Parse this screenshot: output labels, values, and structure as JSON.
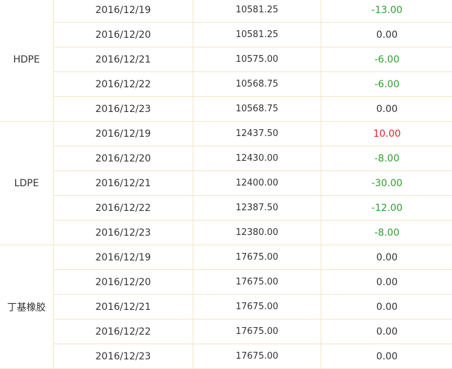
{
  "colors": {
    "border": "#f2e6c8",
    "text": "#333333",
    "negative": "#2e9e2e",
    "positive": "#e0202a"
  },
  "groups": [
    {
      "product": "HDPE",
      "rows": [
        {
          "date": "2016/12/19",
          "price": "10581.25",
          "change": "-13.00",
          "trend": "neg"
        },
        {
          "date": "2016/12/20",
          "price": "10581.25",
          "change": "0.00",
          "trend": "zero"
        },
        {
          "date": "2016/12/21",
          "price": "10575.00",
          "change": "-6.00",
          "trend": "neg"
        },
        {
          "date": "2016/12/22",
          "price": "10568.75",
          "change": "-6.00",
          "trend": "neg"
        },
        {
          "date": "2016/12/23",
          "price": "10568.75",
          "change": "0.00",
          "trend": "zero"
        }
      ]
    },
    {
      "product": "LDPE",
      "rows": [
        {
          "date": "2016/12/19",
          "price": "12437.50",
          "change": "10.00",
          "trend": "pos"
        },
        {
          "date": "2016/12/20",
          "price": "12430.00",
          "change": "-8.00",
          "trend": "neg"
        },
        {
          "date": "2016/12/21",
          "price": "12400.00",
          "change": "-30.00",
          "trend": "neg"
        },
        {
          "date": "2016/12/22",
          "price": "12387.50",
          "change": "-12.00",
          "trend": "neg"
        },
        {
          "date": "2016/12/23",
          "price": "12380.00",
          "change": "-8.00",
          "trend": "neg"
        }
      ]
    },
    {
      "product": "丁基橡胶",
      "rows": [
        {
          "date": "2016/12/19",
          "price": "17675.00",
          "change": "0.00",
          "trend": "zero"
        },
        {
          "date": "2016/12/20",
          "price": "17675.00",
          "change": "0.00",
          "trend": "zero"
        },
        {
          "date": "2016/12/21",
          "price": "17675.00",
          "change": "0.00",
          "trend": "zero"
        },
        {
          "date": "2016/12/22",
          "price": "17675.00",
          "change": "0.00",
          "trend": "zero"
        },
        {
          "date": "2016/12/23",
          "price": "17675.00",
          "change": "0.00",
          "trend": "zero"
        }
      ]
    }
  ]
}
